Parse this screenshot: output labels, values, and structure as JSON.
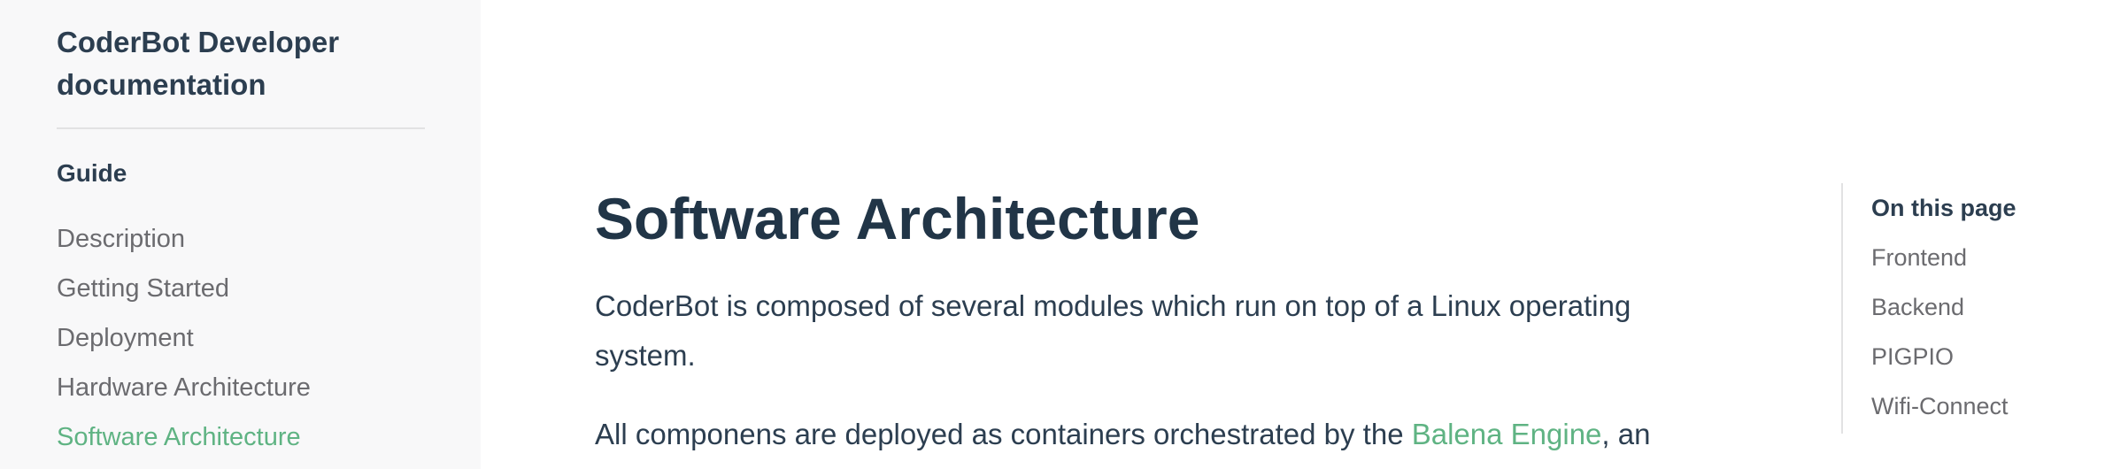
{
  "sidebar": {
    "site_title": "CoderBot Developer documentation",
    "group_title": "Guide",
    "items": [
      {
        "label": "Description",
        "active": false
      },
      {
        "label": "Getting Started",
        "active": false
      },
      {
        "label": "Deployment",
        "active": false
      },
      {
        "label": "Hardware Architecture",
        "active": false
      },
      {
        "label": "Software Architecture",
        "active": true
      }
    ]
  },
  "main": {
    "title": "Software Architecture",
    "paragraph_1": "CoderBot is composed of several modules which run on top of a Linux operating system.",
    "paragraph_2": {
      "before_link": "All componens are deployed as containers orchestrated by the ",
      "link_text": "Balena Engine",
      "after_link": ", an"
    }
  },
  "toc": {
    "title": "On this page",
    "items": [
      "Frontend",
      "Backend",
      "PIGPIO",
      "Wifi-Connect"
    ]
  },
  "colors": {
    "accent": "#5fb383",
    "text": "#213547",
    "muted": "#6b6b6f",
    "sidebar_bg": "#f8f8f9"
  }
}
